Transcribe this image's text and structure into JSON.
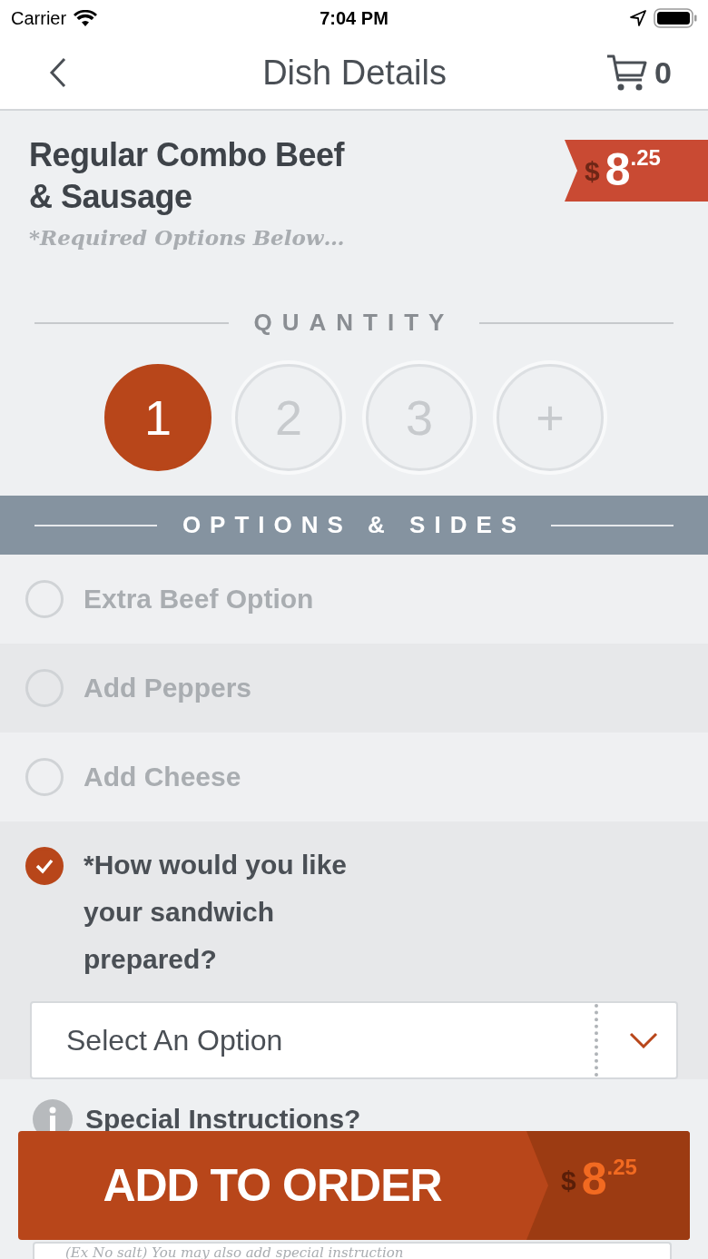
{
  "status_bar": {
    "carrier": "Carrier",
    "time": "7:04 PM"
  },
  "nav": {
    "title": "Dish Details",
    "cart_count": "0"
  },
  "dish": {
    "name": "Regular Combo Beef & Sausage",
    "note": "*Required Options Below…",
    "price": {
      "currency": "$",
      "whole": "8",
      "cents": ".25"
    }
  },
  "quantity": {
    "label": "QUANTITY",
    "options": [
      {
        "label": "1",
        "selected": true
      },
      {
        "label": "2",
        "selected": false
      },
      {
        "label": "3",
        "selected": false
      },
      {
        "label": "+",
        "selected": false
      }
    ]
  },
  "options_header": "OPTIONS & SIDES",
  "options": [
    {
      "label": "Extra Beef Option",
      "checked": false
    },
    {
      "label": "Add Peppers",
      "checked": false
    },
    {
      "label": "Add Cheese",
      "checked": false
    },
    {
      "label": "*How would you like your sandwich prepared?",
      "checked": true,
      "select": {
        "placeholder": "Select An Option"
      }
    }
  ],
  "special": {
    "label": "Special Instructions?",
    "placeholder": "(Ex No salt) You may also add special instruction"
  },
  "add_button": {
    "label": "ADD TO ORDER",
    "price": {
      "currency": "$",
      "whole": "8",
      "cents": ".25"
    }
  }
}
